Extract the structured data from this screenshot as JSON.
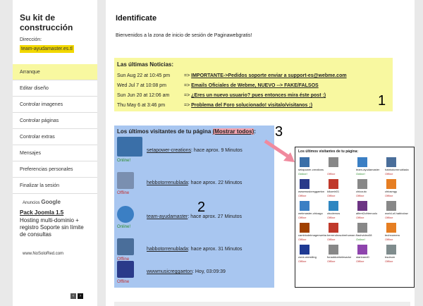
{
  "sidebar": {
    "title": "Su kit de construcción",
    "direction_label": "Dirección:",
    "direction_value": "team-ayudamaster.es.tl",
    "items": [
      {
        "label": "Arranque",
        "active": true
      },
      {
        "label": "Editar diseño",
        "active": false
      },
      {
        "label": "Controlar imagenes",
        "active": false
      },
      {
        "label": "Controlar páginas",
        "active": false
      },
      {
        "label": "Controlar extras",
        "active": false
      },
      {
        "label": "Mensajes",
        "active": false
      },
      {
        "label": "Preferencias personales",
        "active": false
      },
      {
        "label": "Finalizar la sesión",
        "active": false
      }
    ],
    "ads": {
      "label": "Anuncios",
      "brand": "Google",
      "title": "Pack Joomla 1.5",
      "body": "Hosting multi-dominio + registro Soporte sin límite de consultas",
      "url": "www.NoSoloRed.com"
    }
  },
  "main": {
    "title": "Identificate",
    "welcome": "Bienvenidos a la zona de inicio de sesión de Paginawebgratis!",
    "news": {
      "title": "Las últimas Noticias:",
      "items": [
        {
          "date": "Sun Aug 22 at 10:45 pm",
          "arrow": "=>",
          "text": "IMPORTANTE->Pedidos soporte enviar a support-es@webme.com"
        },
        {
          "date": "Wed Jul 7 at 10:08 pm",
          "arrow": "=>",
          "text": "Emails Oficiales de Webme, NUEVO --> FAKE/FALSOS"
        },
        {
          "date": "Sun Jun 20 at 12:06 am",
          "arrow": "=>",
          "text": "¿Eres un nuevo usuario? pues entonces mira éste post :)"
        },
        {
          "date": "Thu May 6 at 3:46 pm",
          "arrow": "=>",
          "text": "Problema del Foro solucionado! visitalo/visitanos ;)"
        }
      ]
    },
    "visitors": {
      "title": "Los últimos visitantes de tu página",
      "show_all": "(Mostrar todos)",
      "colon": ":",
      "items": [
        {
          "name": "setapower-creations",
          "time": ": hace aprox. 9 Minutos",
          "status": "Online!",
          "online": true,
          "color": "#3a6fa8"
        },
        {
          "name": "hebbotorrenublada",
          "time": ": hace aprox. 22 Minutos",
          "status": "Offline",
          "online": false,
          "color": "#7a8fb0"
        },
        {
          "name": "team-ayudamaster",
          "time": ": hace aprox. 27 Minutos",
          "status": "Online!",
          "online": true,
          "color": "#3b7fc4"
        },
        {
          "name": "habbotorrenublada",
          "time": ": hace aprox. 31 Minutos",
          "status": "Offline",
          "online": false,
          "color": "#4a6e9a"
        },
        {
          "name": "wwwmusicreggaeton",
          "time": ": Hoy, 03:09:39",
          "status": "Offline",
          "online": false,
          "color": "#2a3a8a"
        }
      ]
    },
    "annotations": {
      "one": "1",
      "two": "2",
      "three": "3"
    },
    "preview": {
      "title": "Los últimos visitantes de tu página:",
      "items": [
        {
          "name": "setapower-creations",
          "status": "Online!",
          "online": true,
          "color": "#3a6fa8"
        },
        {
          "name": "",
          "status": "Offline",
          "online": false,
          "color": "#888888"
        },
        {
          "name": "team-ayudamaster",
          "status": "Online!",
          "online": true,
          "color": "#3b7fc4"
        },
        {
          "name": "habbotorrenublada",
          "status": "Offline",
          "online": false,
          "color": "#4a6e9a"
        },
        {
          "name": "wwwmusicreggaeton",
          "status": "Offline",
          "online": false,
          "color": "#2a3a8a"
        },
        {
          "name": "kikomb01",
          "status": "Offline",
          "online": false,
          "color": "#c0392b"
        },
        {
          "name": "chicouto",
          "status": "Offline",
          "online": false,
          "color": "#888888"
        },
        {
          "name": "chtosmgy",
          "status": "Offline",
          "online": false,
          "color": "#e67e22"
        },
        {
          "name": "webmaster-chicago",
          "status": "Offline",
          "online": false,
          "color": "#3b7fc4"
        },
        {
          "name": "cbcdemos",
          "status": "Offline",
          "online": false,
          "color": "#2e86c1"
        },
        {
          "name": "alferri2ofrierruolo",
          "status": "Offline",
          "online": false,
          "color": "#6c3483"
        },
        {
          "name": "world-of-habbolow",
          "status": "Offline",
          "online": false,
          "color": "#888888"
        },
        {
          "name": "cambiodeimagenwebapps",
          "status": "Offline",
          "online": false,
          "color": "#a04000"
        },
        {
          "name": "berrendrosobrehumanos",
          "status": "Offline",
          "online": false,
          "color": "#c0392b"
        },
        {
          "name": "flashvideo08",
          "status": "Online!",
          "online": true,
          "color": "#888888"
        },
        {
          "name": "technomeru",
          "status": "Offline",
          "online": false,
          "color": "#e67e22"
        },
        {
          "name": "zone-wrestling",
          "status": "Offline",
          "online": false,
          "color": "#1f3a93"
        },
        {
          "name": "funaddoebelesador",
          "status": "Offline",
          "online": false,
          "color": "#888888"
        },
        {
          "name": "startvand0",
          "status": "Offline",
          "online": false,
          "color": "#8e44ad"
        },
        {
          "name": "bsubum",
          "status": "Offline",
          "online": false,
          "color": "#7f8c8d"
        }
      ]
    }
  }
}
